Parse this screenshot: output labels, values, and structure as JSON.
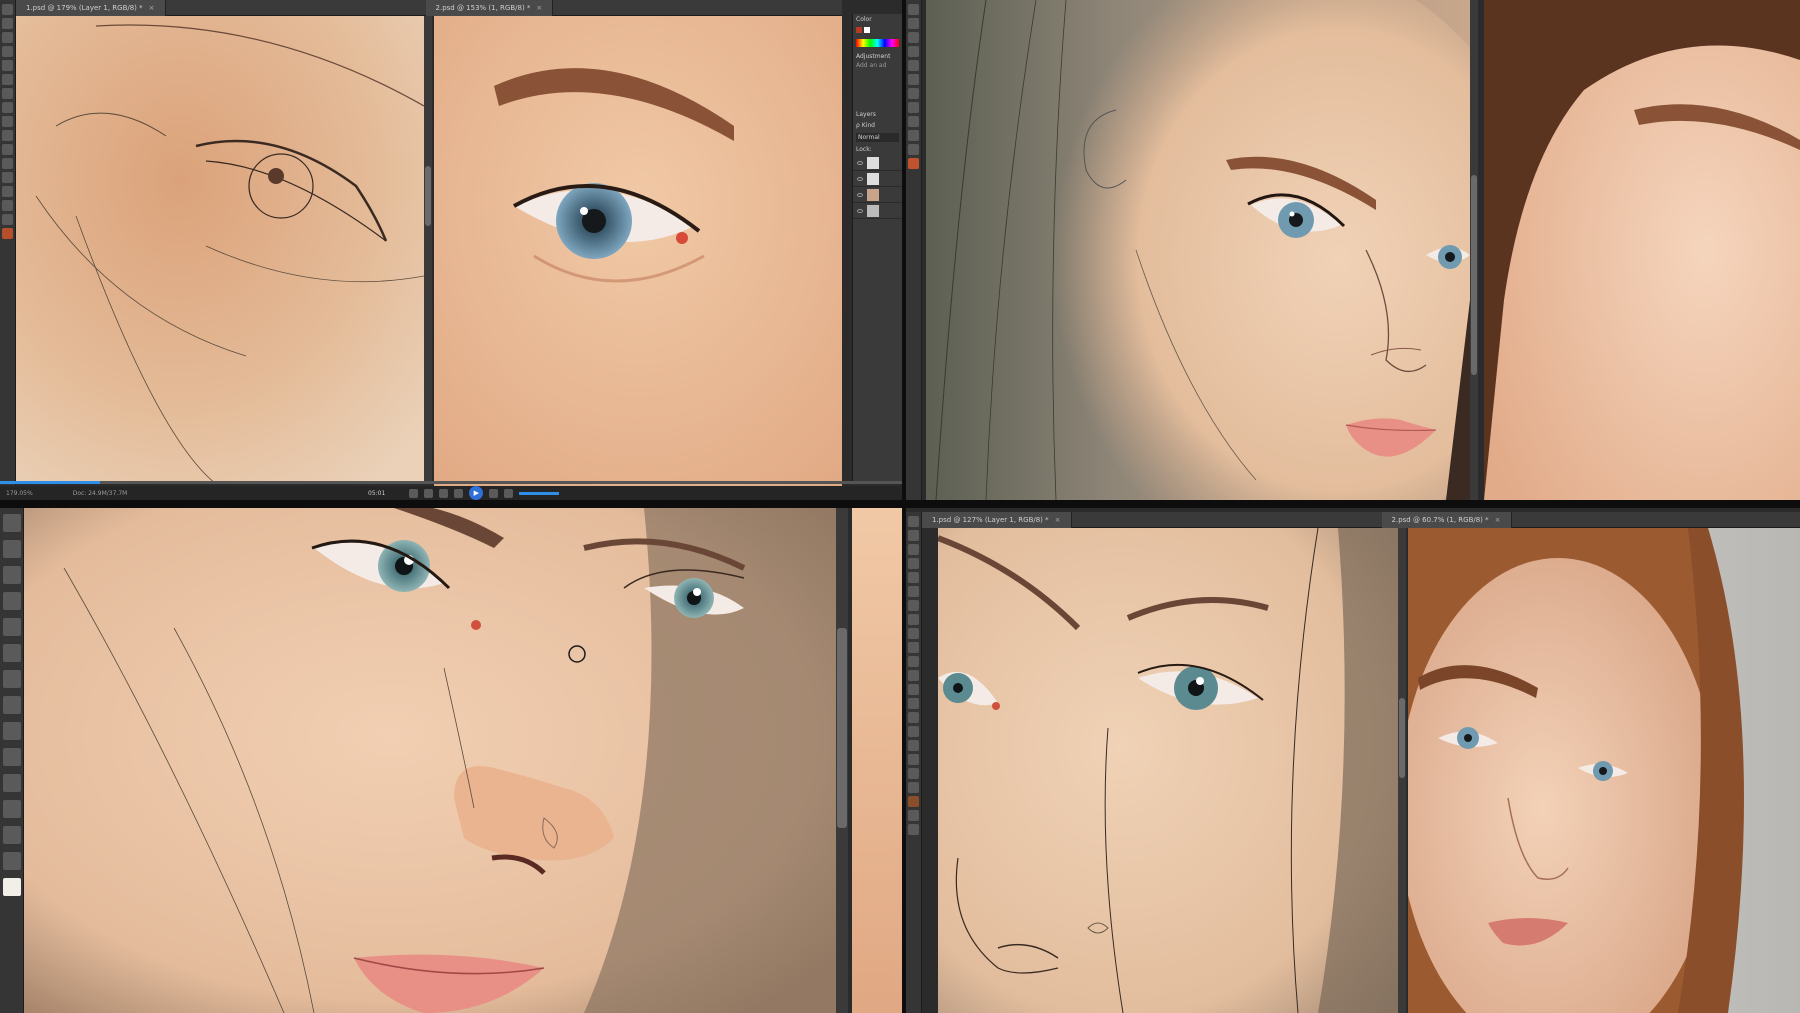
{
  "top_left": {
    "tabs": [
      {
        "label": "1.psd @ 179% (Layer 1, RGB/8) *"
      },
      {
        "label": "2.psd @ 153% (1, RGB/8) *"
      }
    ],
    "status": {
      "zoom": "179.05%",
      "doc_size": "Doc: 24.9M/37.7M"
    },
    "player": {
      "time": "05:01"
    },
    "panel": {
      "color_label": "Color",
      "adjust_label": "Adjustment",
      "adjust_hint": "Add an ad",
      "layers_label": "Layers",
      "kind_label": "ρ Kind",
      "blend_mode": "Normal",
      "lock_label": "Lock:"
    }
  },
  "bottom_right": {
    "tabs": [
      {
        "label": "1.psd @ 127% (Layer 1, RGB/8) *"
      },
      {
        "label": "2.psd @ 60.7% (1, RGB/8) *"
      }
    ]
  },
  "colors": {
    "ui_dark": "#2b2b2b",
    "accent_blue": "#2f8fe8",
    "skin": "#e2b896",
    "lips": "#e88f86",
    "iris": "#6f9ab0",
    "hair": "#8a4e2a"
  },
  "icons": [
    "close-icon",
    "play-icon",
    "eye-icon",
    "brush-icon",
    "move-icon",
    "lasso-icon",
    "hand-icon",
    "zoom-icon",
    "type-icon",
    "cursor-icon"
  ]
}
